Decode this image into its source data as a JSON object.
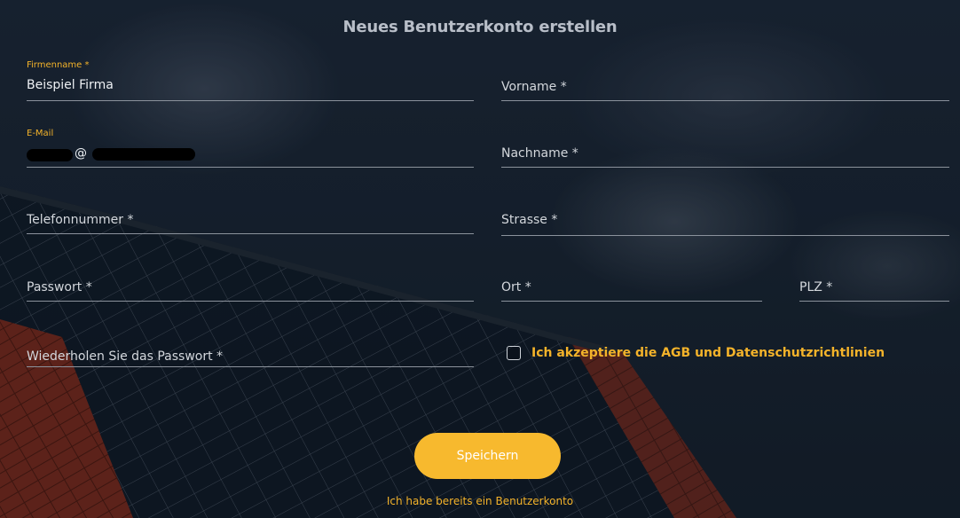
{
  "page": {
    "title": "Neues Benutzerkonto erstellen"
  },
  "form": {
    "company": {
      "label": "Firmenname *",
      "value": "Beispiel Firma"
    },
    "firstname": {
      "placeholder": "Vorname *"
    },
    "email": {
      "label": "E-Mail",
      "value": "@"
    },
    "lastname": {
      "placeholder": "Nachname *"
    },
    "phone": {
      "placeholder": "Telefonnummer *"
    },
    "street": {
      "placeholder": "Strasse *"
    },
    "password": {
      "placeholder": "Passwort *"
    },
    "city": {
      "placeholder": "Ort *"
    },
    "zip": {
      "placeholder": "PLZ *"
    },
    "password_repeat": {
      "placeholder": "Wiederholen Sie das Passwort *"
    },
    "terms": {
      "label": "Ich akzeptiere die AGB und Datenschutzrichtlinien",
      "checked": false
    }
  },
  "actions": {
    "save_label": "Speichern",
    "login_link": "Ich habe bereits ein Benutzerkonto"
  },
  "colors": {
    "accent": "#f7b92e",
    "accent_text": "#f4b32a",
    "background": "#1a2533"
  }
}
